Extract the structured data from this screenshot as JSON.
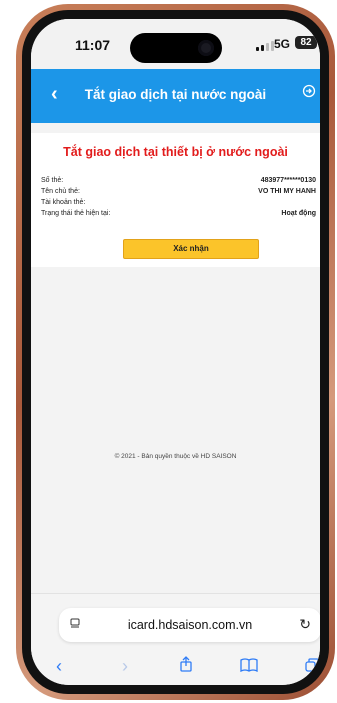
{
  "status_bar": {
    "time": "11:07",
    "network": "5G",
    "battery": "82"
  },
  "header": {
    "title": "Tắt giao dịch tại nước ngoài",
    "back_icon": "chevron-left-icon",
    "logout_icon": "logout-icon",
    "color": "#1c96e8"
  },
  "card": {
    "title": "Tắt giao dịch tại thiết bị ở nước ngoài",
    "rows": [
      {
        "label": "Số thẻ:",
        "value": "483977******0130"
      },
      {
        "label": "Tên chủ thẻ:",
        "value": "VO THI MY HANH"
      },
      {
        "label": "Tài khoản thẻ:",
        "value": ""
      },
      {
        "label": "Trạng thái thẻ hiện tại:",
        "value": "Hoạt động"
      }
    ],
    "confirm_label": "Xác nhận",
    "title_color": "#e21c1c",
    "button_color": "#fbc42a"
  },
  "footer": {
    "copyright": "© 2021 - Bản quyền thuộc về HD SAISON"
  },
  "browser": {
    "url": "icard.hdsaison.com.vn",
    "nav_icons": [
      "back-icon",
      "forward-icon",
      "share-icon",
      "bookmarks-icon",
      "tabs-icon"
    ]
  }
}
